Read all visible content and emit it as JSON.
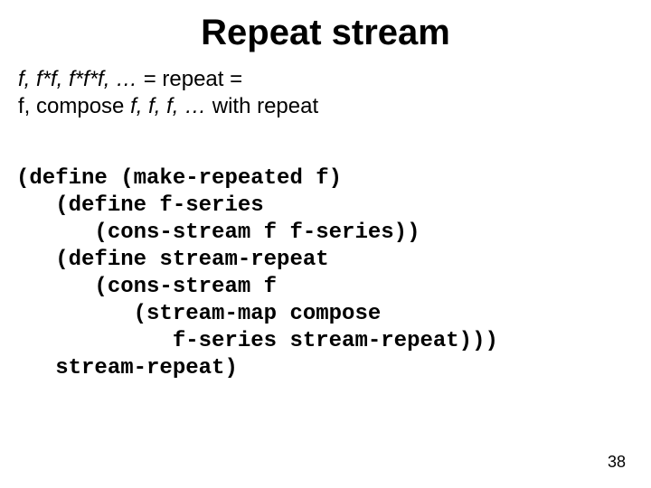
{
  "title": "Repeat stream",
  "desc": {
    "line1_prefix_italic": "f, f*f, f*f*f, …",
    "line1_rest": " = repeat =",
    "line2_prefix": "f, compose ",
    "line2_italic": "f, f, f, …",
    "line2_rest": " with repeat"
  },
  "code_lines": [
    "(define (make-repeated f)",
    "   (define f-series",
    "      (cons-stream f f-series))",
    "   (define stream-repeat",
    "      (cons-stream f",
    "         (stream-map compose",
    "            f-series stream-repeat)))",
    "   stream-repeat)"
  ],
  "page_number": "38"
}
